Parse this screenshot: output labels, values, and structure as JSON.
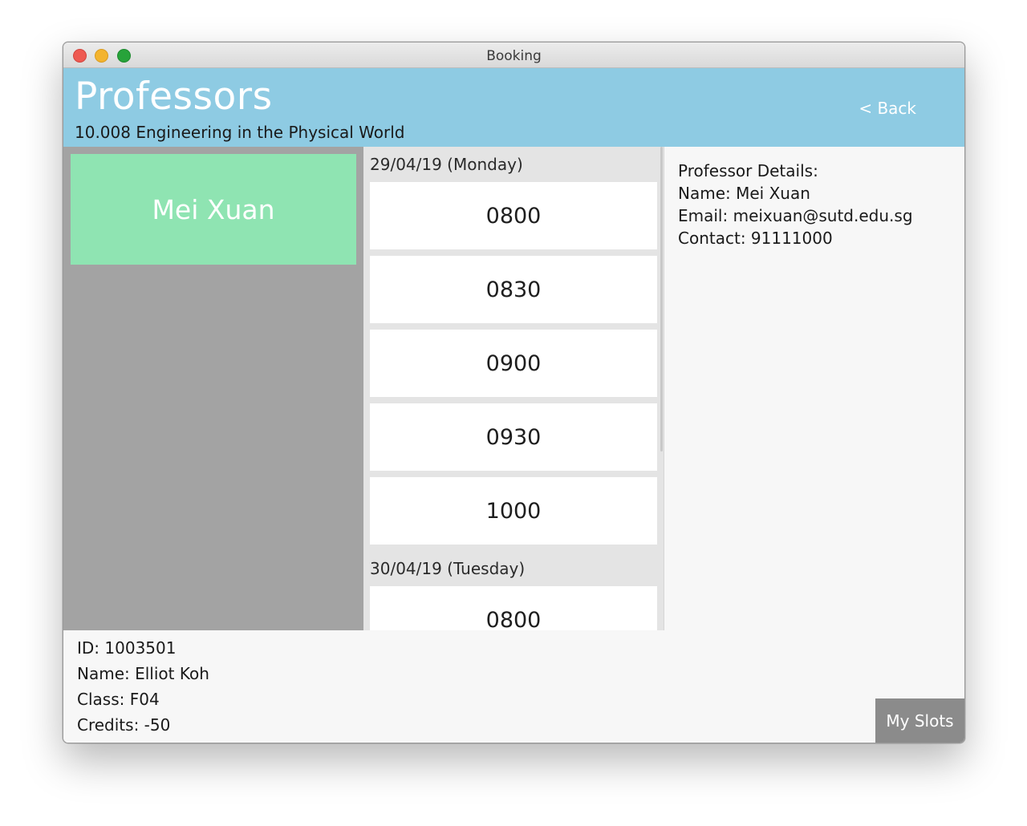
{
  "window": {
    "title": "Booking"
  },
  "header": {
    "title": "Professors",
    "course": "10.008 Engineering in the Physical World",
    "back_label": "< Back"
  },
  "professors": [
    {
      "name": "Mei Xuan",
      "selected": true
    }
  ],
  "schedule": [
    {
      "date": "29/04/19 (Monday)",
      "slots": [
        "0800",
        "0830",
        "0900",
        "0930",
        "1000"
      ]
    },
    {
      "date": "30/04/19 (Tuesday)",
      "slots": [
        "0800"
      ]
    }
  ],
  "details": {
    "heading": "Professor Details:",
    "name": "Name: Mei Xuan",
    "email": "Email: meixuan@sutd.edu.sg",
    "contact": "Contact: 91111000"
  },
  "user": {
    "id": "ID: 1003501",
    "name": "Name: Elliot Koh",
    "class": "Class: F04",
    "credits": "Credits: -50"
  },
  "footer": {
    "my_slots_label": "My Slots"
  },
  "colors": {
    "header_bg": "#8ecbe3",
    "prof_selected_bg": "#8fe4b2",
    "prof_panel_bg": "#a3a3a3",
    "my_slots_bg": "#8b8b8b"
  }
}
